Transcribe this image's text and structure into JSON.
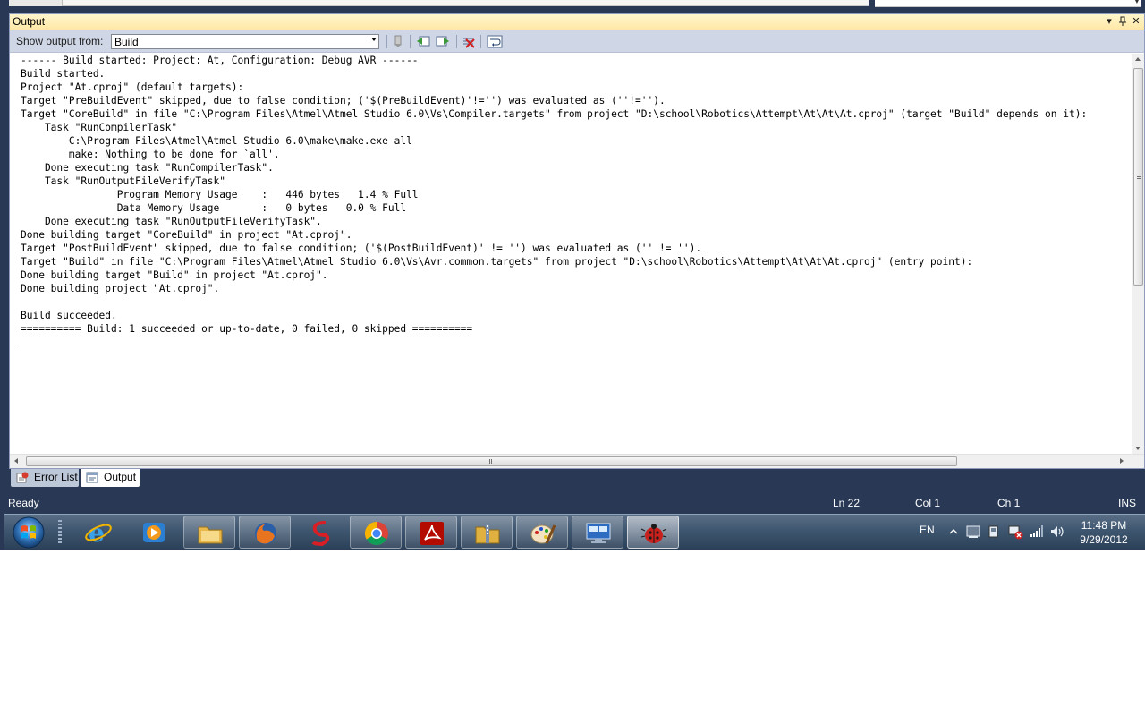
{
  "output_panel": {
    "title": "Output",
    "show_output_from_label": "Show output from:",
    "source": "Build"
  },
  "output_lines": [
    "------ Build started: Project: At, Configuration: Debug AVR ------",
    "Build started.",
    "Project \"At.cproj\" (default targets):",
    "Target \"PreBuildEvent\" skipped, due to false condition; ('$(PreBuildEvent)'!='') was evaluated as (''!='').",
    "Target \"CoreBuild\" in file \"C:\\Program Files\\Atmel\\Atmel Studio 6.0\\Vs\\Compiler.targets\" from project \"D:\\school\\Robotics\\Attempt\\At\\At\\At.cproj\" (target \"Build\" depends on it):",
    "    Task \"RunCompilerTask\"",
    "        C:\\Program Files\\Atmel\\Atmel Studio 6.0\\make\\make.exe all",
    "        make: Nothing to be done for `all'.",
    "    Done executing task \"RunCompilerTask\".",
    "    Task \"RunOutputFileVerifyTask\"",
    "                Program Memory Usage    :   446 bytes   1.4 % Full",
    "                Data Memory Usage       :   0 bytes   0.0 % Full",
    "    Done executing task \"RunOutputFileVerifyTask\".",
    "Done building target \"CoreBuild\" in project \"At.cproj\".",
    "Target \"PostBuildEvent\" skipped, due to false condition; ('$(PostBuildEvent)' != '') was evaluated as ('' != '').",
    "Target \"Build\" in file \"C:\\Program Files\\Atmel\\Atmel Studio 6.0\\Vs\\Avr.common.targets\" from project \"D:\\school\\Robotics\\Attempt\\At\\At\\At.cproj\" (entry point):",
    "Done building target \"Build\" in project \"At.cproj\".",
    "Done building project \"At.cproj\".",
    "",
    "Build succeeded.",
    "========== Build: 1 succeeded or up-to-date, 0 failed, 0 skipped =========="
  ],
  "tabs": {
    "error_list": "Error List",
    "output": "Output"
  },
  "status_bar": {
    "state": "Ready",
    "line": "Ln 22",
    "col": "Col 1",
    "ch": "Ch 1",
    "mode": "INS"
  },
  "taskbar": {
    "apps": [
      "internet-explorer-icon",
      "media-player-icon",
      "file-explorer-icon",
      "firefox-icon",
      "slingshot-icon",
      "chrome-icon",
      "acrobat-icon",
      "archive-icon",
      "paint-icon",
      "remote-desktop-icon",
      "atmel-studio-icon"
    ],
    "language": "EN",
    "time": "11:48 PM",
    "date": "9/29/2012"
  },
  "colors": {
    "vs_frame": "#293955",
    "output_title_bg": "#ffe8a6",
    "toolbar_bg": "#cfd6e5",
    "status_text": "#ffffff"
  }
}
